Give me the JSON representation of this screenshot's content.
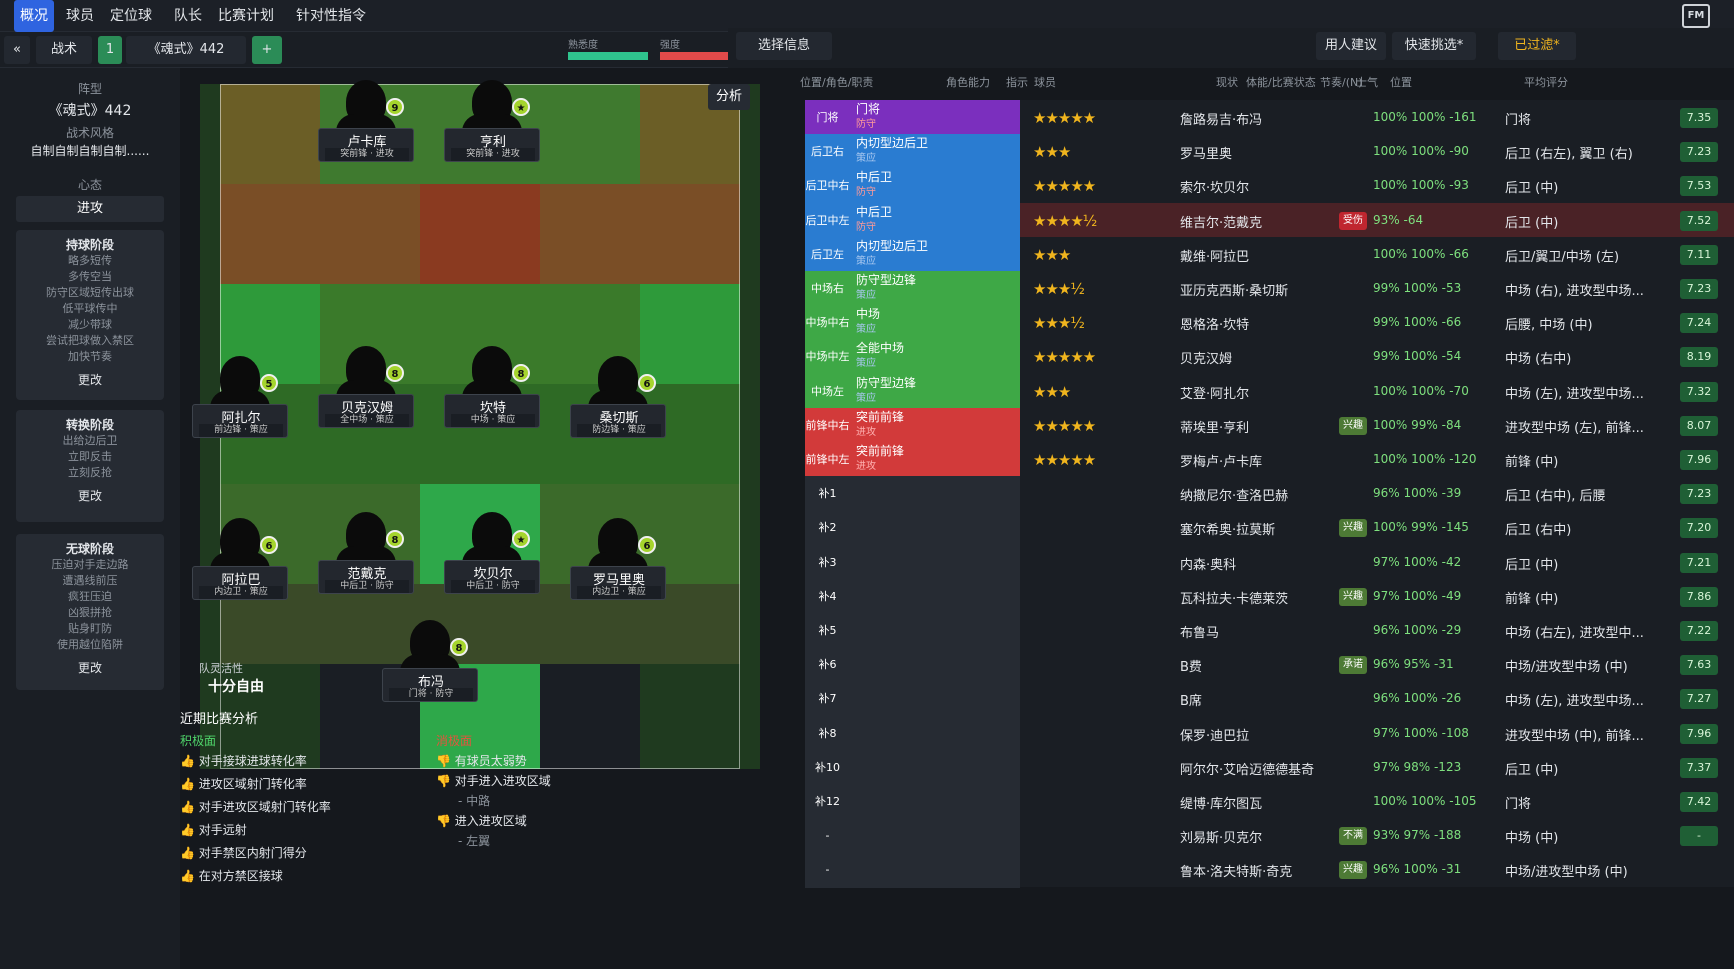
{
  "topbar": {
    "items": [
      "概况",
      "球员",
      "定位球",
      "队长",
      "比赛计划",
      "针对性指令"
    ]
  },
  "toolbar": {
    "tactics": "战术",
    "slot": "1",
    "formation": "《魂式》442",
    "familiarity": "熟悉度",
    "intensity": "强度"
  },
  "left": {
    "formation_label": "阵型",
    "formation": "《魂式》442",
    "style_label": "战术风格",
    "style": "自制自制自制自制......",
    "mentality_label": "心态",
    "mentality": "进攻",
    "phases": [
      {
        "title": "持球阶段",
        "items": [
          "略多短传",
          "多传空当",
          "防守区域短传出球",
          "低平球传中",
          "减少带球",
          "尝试把球做入禁区",
          "加快节奏"
        ],
        "more": "更改"
      },
      {
        "title": "转换阶段",
        "items": [
          "出给边后卫",
          "立即反击",
          "立刻反抢"
        ],
        "more": "更改"
      },
      {
        "title": "无球阶段",
        "items": [
          "压迫对手走边路",
          "遭遇线前压",
          "疯狂压迫",
          "凶狠拼抢",
          "贴身盯防",
          "使用越位陷阱"
        ],
        "more": "更改"
      }
    ]
  },
  "pitch": {
    "analysis": "分析",
    "flex_label": "球队灵活性",
    "flex": "十分自由",
    "players": [
      {
        "name": "卢卡库",
        "role": "突前锋 · 进攻",
        "num": "9"
      },
      {
        "name": "亨利",
        "role": "突前锋 · 进攻",
        "num": "★"
      },
      {
        "name": "阿扎尔",
        "role": "前边锋 · 策应",
        "num": "5"
      },
      {
        "name": "贝克汉姆",
        "role": "全中场 · 策应",
        "num": "8"
      },
      {
        "name": "坎特",
        "role": "中场 · 策应",
        "num": "8"
      },
      {
        "name": "桑切斯",
        "role": "防边锋 · 策应",
        "num": "6"
      },
      {
        "name": "阿拉巴",
        "role": "内边卫 · 策应",
        "num": "6"
      },
      {
        "name": "范戴克",
        "role": "中后卫 · 防守",
        "num": "8"
      },
      {
        "name": "坎贝尔",
        "role": "中后卫 · 防守",
        "num": "★"
      },
      {
        "name": "罗马里奥",
        "role": "内边卫 · 策应",
        "num": "6"
      },
      {
        "name": "布冯",
        "role": "门将 · 防守",
        "num": "8"
      }
    ]
  },
  "analysis": {
    "title": "近期比赛分析",
    "pos_label": "积极面",
    "neg_label": "消极面",
    "positives": [
      "对手接球进球转化率",
      "进攻区域射门转化率",
      "对手进攻区域射门转化率",
      "对手远射",
      "对手禁区内射门得分",
      "在对方禁区接球"
    ],
    "negatives": [
      "有球员太弱势",
      "对手进入进攻区域",
      "- 中路",
      "进入进攻区域",
      "- 左翼"
    ]
  },
  "right": {
    "select_info": "选择信息",
    "suggest": "用人建议",
    "quick": "快速挑选*",
    "filtered": "已过滤*",
    "headers": [
      "位置/角色/职责",
      "角色能力",
      "指示",
      "球员",
      "现状",
      "体能/比赛状态",
      "节奏/(N)",
      "士气",
      "位置",
      "平均评分"
    ],
    "rows": [
      {
        "pos": "门将",
        "role": "门将",
        "duty": "防守",
        "stars": "★★★★★",
        "name": "詹路易吉·布冯",
        "fit": "100% 100% -161",
        "posn": "门将",
        "rating": "7.35",
        "color": "#7b2fbe",
        "status": ""
      },
      {
        "pos": "后卫右",
        "role": "内切型边后卫",
        "duty": "策应",
        "stars": "★★★",
        "name": "罗马里奥",
        "fit": "100% 100% -90",
        "posn": "后卫 (右左), 翼卫 (右)",
        "rating": "7.23",
        "color": "#2a7cd1",
        "status": ""
      },
      {
        "pos": "后卫中右",
        "role": "中后卫",
        "duty": "防守",
        "stars": "★★★★★",
        "name": "索尔·坎贝尔",
        "fit": "100% 100% -93",
        "posn": "后卫 (中)",
        "rating": "7.53",
        "color": "#2a7cd1",
        "status": ""
      },
      {
        "pos": "后卫中左",
        "role": "中后卫",
        "duty": "防守",
        "stars": "★★★★½",
        "name": "维吉尔·范戴克",
        "fit": "93% -64",
        "posn": "后卫 (中)",
        "rating": "7.52",
        "color": "#2a7cd1",
        "status": "受伤"
      },
      {
        "pos": "后卫左",
        "role": "内切型边后卫",
        "duty": "策应",
        "stars": "★★★",
        "name": "戴维·阿拉巴",
        "fit": "100% 100% -66",
        "posn": "后卫/翼卫/中场 (左)",
        "rating": "7.11",
        "color": "#2a7cd1",
        "status": ""
      },
      {
        "pos": "中场右",
        "role": "防守型边锋",
        "duty": "策应",
        "stars": "★★★½",
        "name": "亚历克西斯·桑切斯",
        "fit": "99% 100% -53",
        "posn": "中场 (右), 进攻型中场...",
        "rating": "7.23",
        "color": "#3ea846",
        "status": ""
      },
      {
        "pos": "中场中右",
        "role": "中场",
        "duty": "策应",
        "stars": "★★★½",
        "name": "恩格洛·坎特",
        "fit": "99% 100% -66",
        "posn": "后腰, 中场 (中)",
        "rating": "7.24",
        "color": "#3ea846",
        "status": ""
      },
      {
        "pos": "中场中左",
        "role": "全能中场",
        "duty": "策应",
        "stars": "★★★★★",
        "name": "贝克汉姆",
        "fit": "99% 100% -54",
        "posn": "中场 (右中)",
        "rating": "8.19",
        "color": "#3ea846",
        "status": ""
      },
      {
        "pos": "中场左",
        "role": "防守型边锋",
        "duty": "策应",
        "stars": "★★★",
        "name": "艾登·阿扎尔",
        "fit": "100% 100% -70",
        "posn": "中场 (左), 进攻型中场...",
        "rating": "7.32",
        "color": "#3ea846",
        "status": ""
      },
      {
        "pos": "前锋中右",
        "role": "突前前锋",
        "duty": "进攻",
        "stars": "★★★★★",
        "name": "蒂埃里·亨利",
        "fit": "100% 99% -84",
        "posn": "进攻型中场 (左), 前锋...",
        "rating": "8.07",
        "color": "#d23a3a",
        "status": "兴趣"
      },
      {
        "pos": "前锋中左",
        "role": "突前前锋",
        "duty": "进攻",
        "stars": "★★★★★",
        "name": "罗梅卢·卢卡库",
        "fit": "100% 100% -120",
        "posn": "前锋 (中)",
        "rating": "7.96",
        "color": "#d23a3a",
        "status": ""
      },
      {
        "pos": "补1",
        "role": "",
        "duty": "",
        "stars": "",
        "name": "纳撒尼尔·查洛巴赫",
        "fit": "96% 100% -39",
        "posn": "后卫 (右中), 后腰",
        "rating": "7.23",
        "color": "",
        "status": ""
      },
      {
        "pos": "补2",
        "role": "",
        "duty": "",
        "stars": "",
        "name": "塞尔希奥·拉莫斯",
        "fit": "100% 99% -145",
        "posn": "后卫 (右中)",
        "rating": "7.20",
        "color": "",
        "status": "兴趣"
      },
      {
        "pos": "补3",
        "role": "",
        "duty": "",
        "stars": "",
        "name": "内森·奥科",
        "fit": "97% 100% -42",
        "posn": "后卫 (中)",
        "rating": "7.21",
        "color": "",
        "status": ""
      },
      {
        "pos": "补4",
        "role": "",
        "duty": "",
        "stars": "",
        "name": "瓦科拉夫·卡德莱茨",
        "fit": "97% 100% -49",
        "posn": "前锋 (中)",
        "rating": "7.86",
        "color": "",
        "status": "兴趣"
      },
      {
        "pos": "补5",
        "role": "",
        "duty": "",
        "stars": "",
        "name": "布鲁马",
        "fit": "96% 100% -29",
        "posn": "中场 (右左), 进攻型中...",
        "rating": "7.22",
        "color": "",
        "status": ""
      },
      {
        "pos": "补6",
        "role": "",
        "duty": "",
        "stars": "",
        "name": "B费",
        "fit": "96% 95% -31",
        "posn": "中场/进攻型中场 (中)",
        "rating": "7.63",
        "color": "",
        "status": "承诺"
      },
      {
        "pos": "补7",
        "role": "",
        "duty": "",
        "stars": "",
        "name": "B席",
        "fit": "96% 100% -26",
        "posn": "中场 (左), 进攻型中场...",
        "rating": "7.27",
        "color": "",
        "status": ""
      },
      {
        "pos": "补8",
        "role": "",
        "duty": "",
        "stars": "",
        "name": "保罗·迪巴拉",
        "fit": "97% 100% -108",
        "posn": "进攻型中场 (中), 前锋...",
        "rating": "7.96",
        "color": "",
        "status": ""
      },
      {
        "pos": "补10",
        "role": "",
        "duty": "",
        "stars": "",
        "name": "阿尔尔·艾哈迈德德基奇",
        "fit": "97% 98% -123",
        "posn": "后卫 (中)",
        "rating": "7.37",
        "color": "",
        "status": ""
      },
      {
        "pos": "补12",
        "role": "",
        "duty": "",
        "stars": "",
        "name": "缇博·库尔图瓦",
        "fit": "100% 100% -105",
        "posn": "门将",
        "rating": "7.42",
        "color": "",
        "status": ""
      },
      {
        "pos": "-",
        "role": "",
        "duty": "",
        "stars": "",
        "name": "刘易斯·贝克尔",
        "fit": "93% 97% -188",
        "posn": "中场 (中)",
        "rating": "-",
        "color": "",
        "status": "不满"
      },
      {
        "pos": "-",
        "role": "",
        "duty": "",
        "stars": "",
        "name": "鲁本·洛夫特斯·奇克",
        "fit": "96% 100% -31",
        "posn": "中场/进攻型中场 (中)",
        "rating": "",
        "color": "",
        "status": "兴趣"
      }
    ]
  }
}
